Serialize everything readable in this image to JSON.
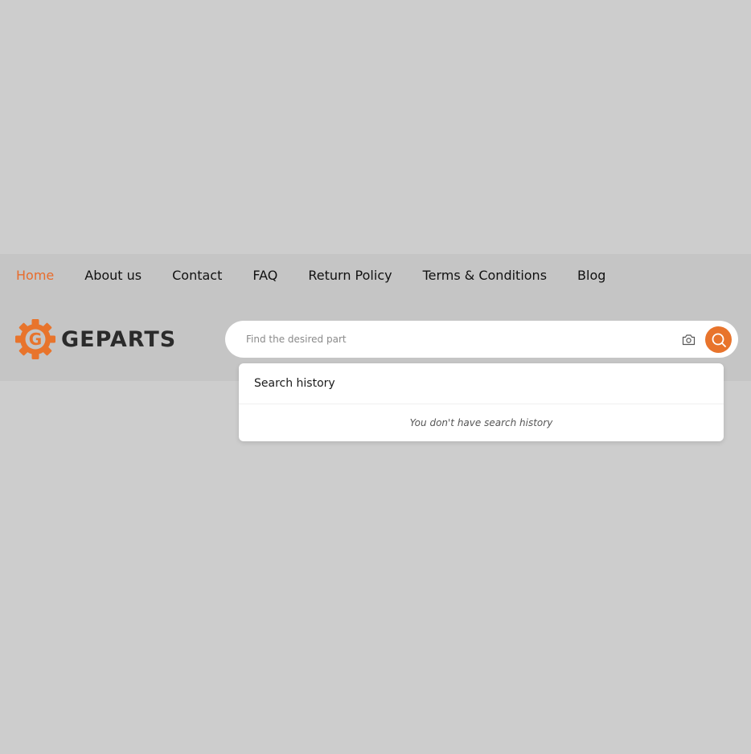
{
  "nav": {
    "items": [
      {
        "label": "Home",
        "active": true
      },
      {
        "label": "About us"
      },
      {
        "label": "Contact"
      },
      {
        "label": "FAQ"
      },
      {
        "label": "Return Policy"
      },
      {
        "label": "Terms & Conditions"
      },
      {
        "label": "Blog"
      }
    ]
  },
  "logo": {
    "letter": "G",
    "text": "GEPARTS",
    "icon": "gear-icon",
    "color": "#e8742c"
  },
  "search": {
    "placeholder": "Find the desired part",
    "value": "",
    "camera_icon": "camera-icon",
    "search_icon": "search-icon",
    "button_color": "#e8742c"
  },
  "history": {
    "title": "Search history",
    "empty_text": "You don't have search history"
  },
  "colors": {
    "accent": "#e86c2c",
    "background": "#cdcdcd",
    "header": "#c5c5c5"
  }
}
